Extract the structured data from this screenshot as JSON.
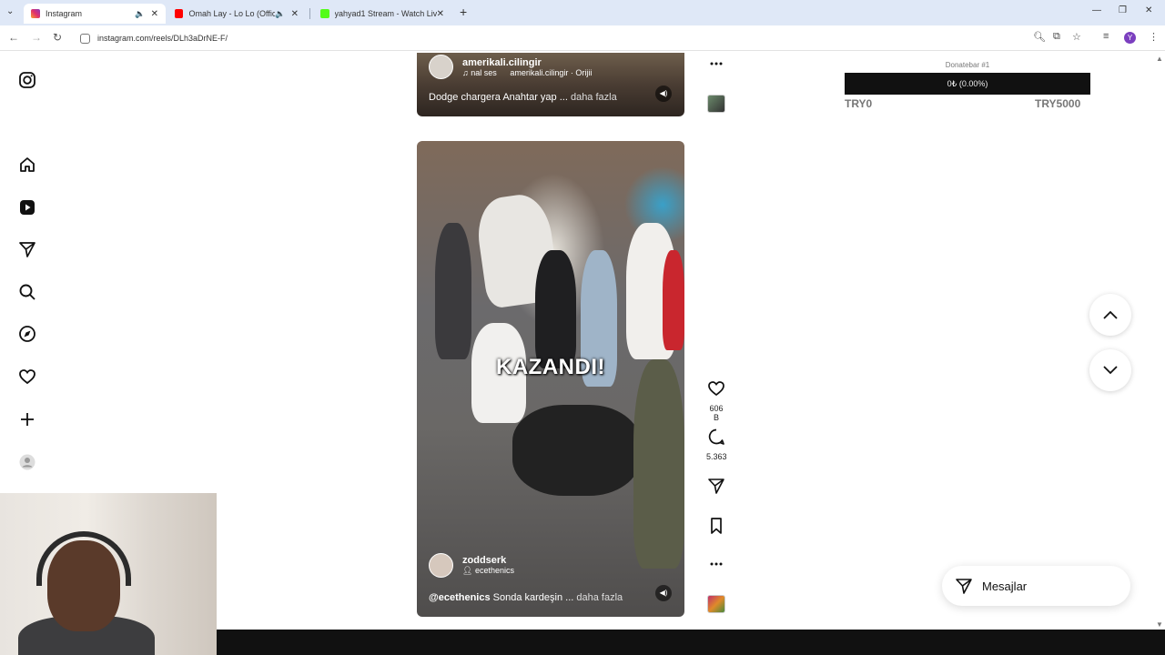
{
  "browser": {
    "tabs": [
      {
        "title": "Instagram",
        "active": true,
        "color": "#e1306c"
      },
      {
        "title": "Omah Lay - Lo Lo (Official V",
        "active": false,
        "color": "#ff0000"
      },
      {
        "title": "yahyad1 Stream - Watch Live o",
        "active": false,
        "color": "#53fc18"
      }
    ],
    "new_tab": "+",
    "url": "instagram.com/reels/DLh3aDrNE-F/",
    "profile_initial": "Y"
  },
  "reels": {
    "top": {
      "username": "amerikali.cilingir",
      "audio": "nal ses",
      "audio_extra": "amerikali.cilingir · Orijii",
      "description": "Dodge chargera Anahtar yap ...",
      "more": "daha fazla"
    },
    "main": {
      "overlay_text": "KAZANDI!",
      "username": "zoddserk",
      "collab": "ecethenics",
      "desc_tag": "@ecethenics",
      "description": " Sonda kardeşin ...",
      "more": "daha fazla"
    }
  },
  "actions": {
    "likes": "606 B",
    "comments": "5.363"
  },
  "donatebar": {
    "title": "Donatebar #1",
    "progress_text": "0₺ (0.00%)",
    "progress": 0,
    "min": "TRY0",
    "max": "TRY5000"
  },
  "messages": {
    "label": "Mesajlar"
  }
}
